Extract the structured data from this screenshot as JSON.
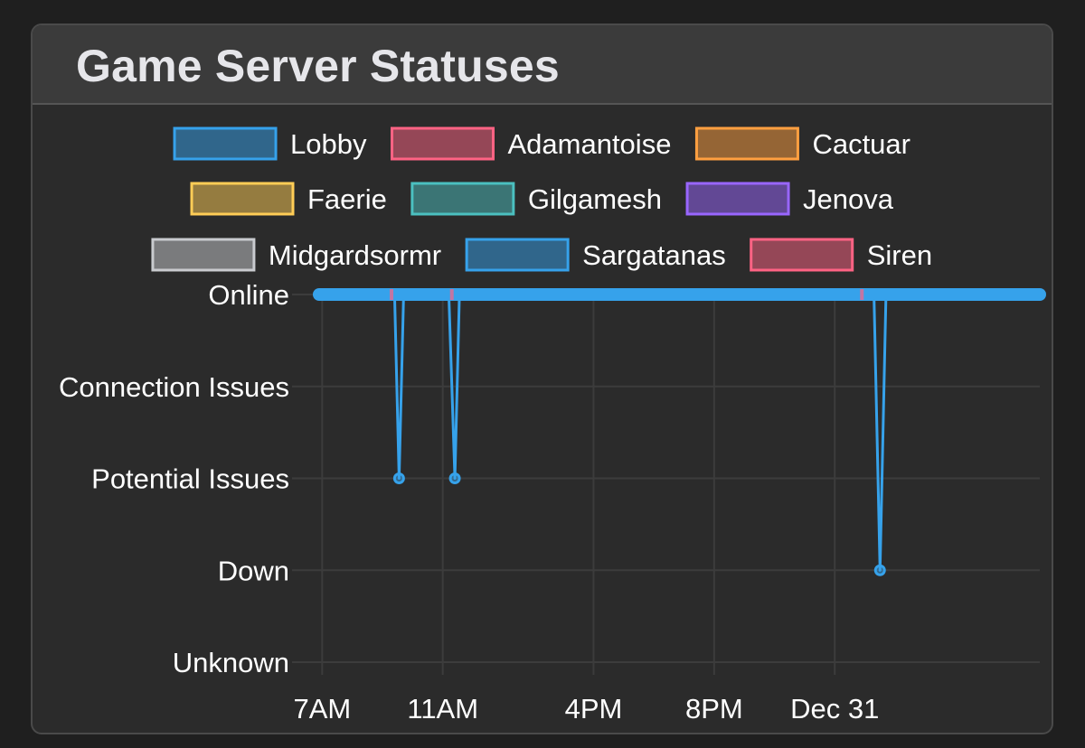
{
  "panel": {
    "title": "Game Server Statuses"
  },
  "colors": {
    "page_background": "#1f1f1f",
    "panel_background": "#2b2b2b",
    "header_background": "#3b3b3b",
    "grid": "#3c3c3c",
    "text": "#ffffff"
  },
  "chart_data": {
    "type": "line",
    "title": "Game Server Statuses",
    "xlabel": "",
    "ylabel": "",
    "legend_position": "top",
    "grid": true,
    "y_categories": [
      "Unknown",
      "Down",
      "Potential Issues",
      "Connection Issues",
      "Online"
    ],
    "x_tick_labels": [
      "7AM",
      "11AM",
      "4PM",
      "8PM",
      "Dec 31"
    ],
    "x_range_hours": [
      6.9,
      30.8
    ],
    "series": [
      {
        "name": "Lobby",
        "color": "#36a2eb",
        "points": [
          [
            6.9,
            "Online"
          ],
          [
            9.4,
            "Online"
          ],
          [
            9.55,
            "Potential Issues"
          ],
          [
            9.7,
            "Online"
          ],
          [
            11.2,
            "Online"
          ],
          [
            11.4,
            "Potential Issues"
          ],
          [
            11.55,
            "Online"
          ],
          [
            25.3,
            "Online"
          ],
          [
            25.5,
            "Down"
          ],
          [
            25.7,
            "Online"
          ],
          [
            30.8,
            "Online"
          ]
        ]
      },
      {
        "name": "Adamantoise",
        "color": "#ff6384",
        "points": [
          [
            6.9,
            "Online"
          ],
          [
            30.8,
            "Online"
          ]
        ]
      },
      {
        "name": "Cactuar",
        "color": "#ff9f40",
        "points": [
          [
            6.9,
            "Online"
          ],
          [
            30.8,
            "Online"
          ]
        ]
      },
      {
        "name": "Faerie",
        "color": "#ffcd56",
        "points": [
          [
            6.9,
            "Online"
          ],
          [
            30.8,
            "Online"
          ]
        ]
      },
      {
        "name": "Gilgamesh",
        "color": "#4bc0c0",
        "points": [
          [
            6.9,
            "Online"
          ],
          [
            30.8,
            "Online"
          ]
        ]
      },
      {
        "name": "Jenova",
        "color": "#9966ff",
        "points": [
          [
            6.9,
            "Online"
          ],
          [
            30.8,
            "Online"
          ]
        ]
      },
      {
        "name": "Midgardsormr",
        "color": "#c9cbcf",
        "points": [
          [
            6.9,
            "Online"
          ],
          [
            30.8,
            "Online"
          ]
        ]
      },
      {
        "name": "Sargatanas",
        "color": "#36a2eb",
        "points": [
          [
            6.9,
            "Online"
          ],
          [
            30.8,
            "Online"
          ]
        ]
      },
      {
        "name": "Siren",
        "color": "#ff6384",
        "points": [
          [
            6.9,
            "Online"
          ],
          [
            30.8,
            "Online"
          ]
        ]
      }
    ]
  }
}
